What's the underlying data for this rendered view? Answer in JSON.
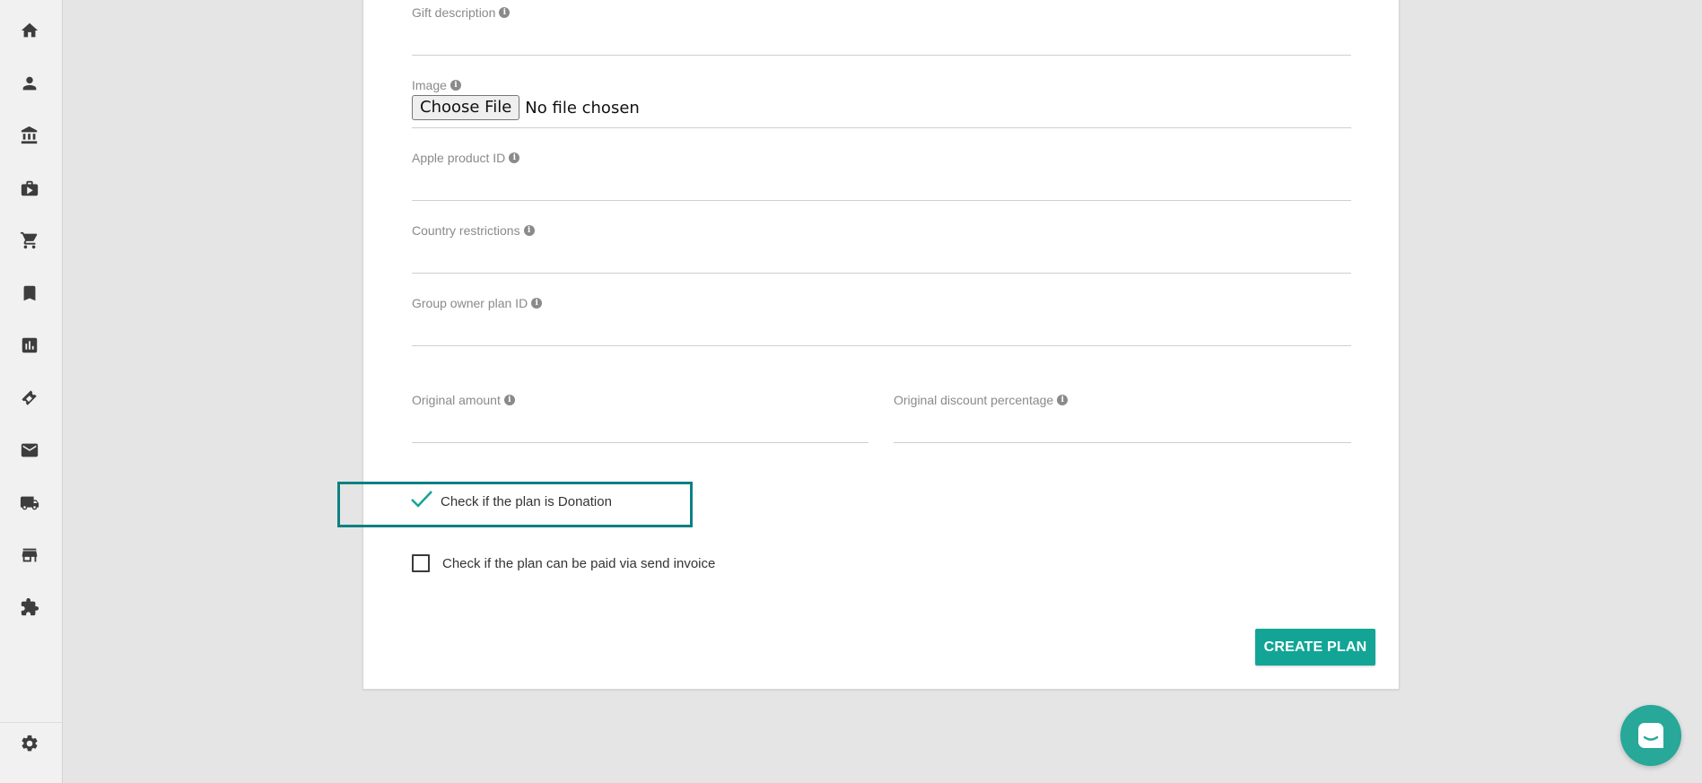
{
  "sidebar": {
    "items": [
      {
        "icon": "home-icon"
      },
      {
        "icon": "person-icon"
      },
      {
        "icon": "bank-icon"
      },
      {
        "icon": "briefcase-icon"
      },
      {
        "icon": "cart-icon"
      },
      {
        "icon": "bookmark-icon"
      },
      {
        "icon": "bar-chart-icon"
      },
      {
        "icon": "ticket-icon"
      },
      {
        "icon": "mail-icon"
      },
      {
        "icon": "truck-icon"
      },
      {
        "icon": "store-icon"
      },
      {
        "icon": "puzzle-icon"
      }
    ],
    "settings_icon": "gear-icon"
  },
  "form": {
    "gift_description": {
      "label": "Gift description",
      "value": ""
    },
    "image": {
      "label": "Image",
      "button_label": "Choose File",
      "status": "No file chosen"
    },
    "apple_product_id": {
      "label": "Apple product ID",
      "value": ""
    },
    "country_restrictions": {
      "label": "Country restrictions",
      "value": ""
    },
    "group_owner_plan_id": {
      "label": "Group owner plan ID",
      "value": ""
    },
    "original_amount": {
      "label": "Original amount",
      "value": ""
    },
    "original_discount_percentage": {
      "label": "Original discount percentage",
      "value": ""
    },
    "donation_checkbox": {
      "label": "Check if the plan is Donation",
      "checked": true
    },
    "send_invoice_checkbox": {
      "label": "Check if the plan can be paid via send invoice",
      "checked": false
    },
    "submit_label": "CREATE PLAN"
  },
  "colors": {
    "accent": "#12a596",
    "highlight_border": "#0f8082",
    "chat_launcher": "#27a898"
  }
}
